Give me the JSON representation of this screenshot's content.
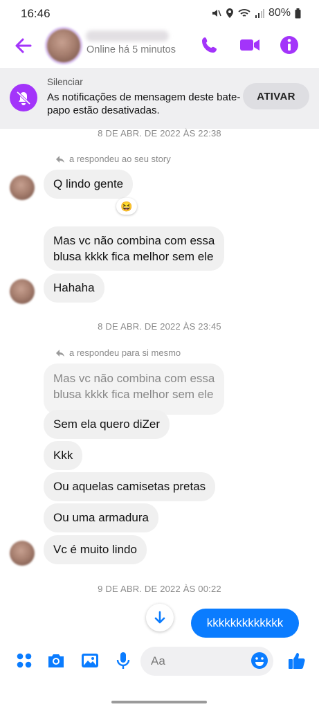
{
  "status_bar": {
    "time": "16:46",
    "battery": "80%"
  },
  "header": {
    "active_status": "Online há 5 minutos",
    "accent_color": "#a334fa"
  },
  "banner": {
    "title": "Silenciar",
    "text": "As notificações de mensagem deste bate-papo estão desativadas.",
    "button": "ATIVAR"
  },
  "timestamps": [
    "8 DE ABR. DE 2022 ÀS 22:38",
    "8 DE ABR. DE 2022 ÀS 23:45",
    "9 DE ABR. DE 2022 ÀS 00:22"
  ],
  "notes": {
    "story_reply": "a respondeu ao seu story",
    "self_reply": "a respondeu para si mesmo"
  },
  "messages": {
    "m1": "Q lindo gente",
    "reaction": "😆",
    "m2_line1": "Mas vc não combina com essa",
    "m2_line2": "blusa kkkk fica melhor sem ele",
    "m3": "Hahaha",
    "quoted_line1": "Mas vc não combina com essa",
    "quoted_line2": "blusa kkkk fica melhor sem ele",
    "m4": "Sem ela quero diZer",
    "m5": "Kkk",
    "m6": "Ou aquelas camisetas pretas",
    "m7": "Ou uma armadura",
    "m8": "Vc é muito lindo",
    "sent1": "kkkkkkkkkkkkk"
  },
  "composer": {
    "placeholder": "Aa"
  },
  "icons": [
    "back-arrow-icon",
    "phone-icon",
    "video-camera-icon",
    "info-icon",
    "muted-bell-icon",
    "reply-arrow-icon",
    "apps-icon",
    "camera-icon",
    "gallery-icon",
    "microphone-icon",
    "emoji-icon",
    "like-icon",
    "scroll-down-icon"
  ],
  "colors": {
    "messenger_blue": "#0a7cff",
    "purple": "#a334fa"
  }
}
